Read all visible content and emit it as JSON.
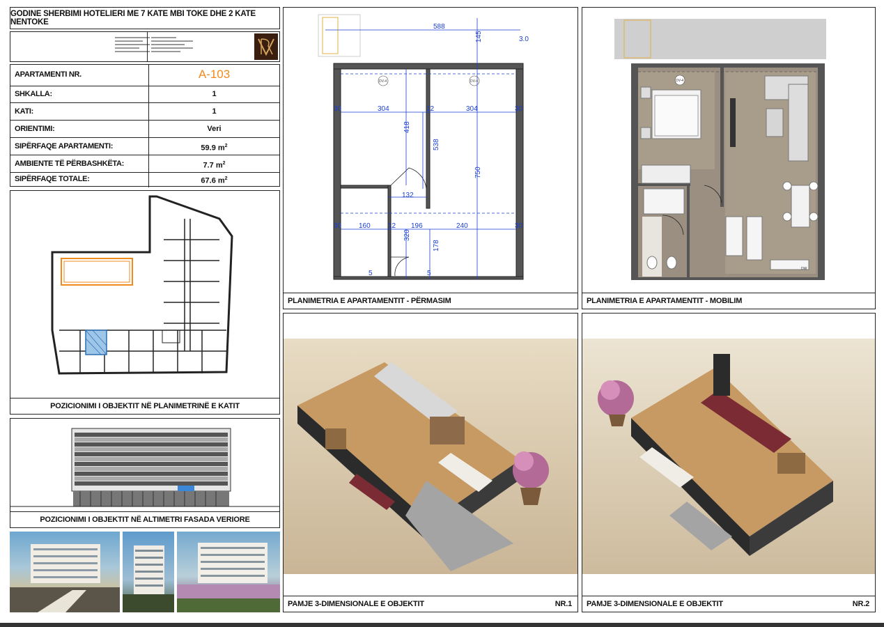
{
  "header": {
    "title": "GODINE SHERBIMI HOTELIERI ME 7 KATE MBI TOKE DHE 2 KATE NENTOKE"
  },
  "info_table": {
    "rows": [
      {
        "label": "APARTAMENTI NR.",
        "value": "A-103"
      },
      {
        "label": "SHKALLA:",
        "value": "1"
      },
      {
        "label": "KATI:",
        "value": "1"
      },
      {
        "label": "ORIENTIMI:",
        "value": "Veri"
      },
      {
        "label": "SIPËRFAQE APARTAMENTI:",
        "value": "59.9 m",
        "unit": "2"
      },
      {
        "label": "AMBIENTE TË PËRBASHKËTA:",
        "value": "7.7 m",
        "unit": "2"
      },
      {
        "label": "SIPËRFAQE TOTALE:",
        "value": "67.6 m",
        "unit": "2"
      }
    ],
    "accent": "#f08a1c"
  },
  "captions": {
    "floor_position": "POZICIONIMI I OBJEKTIT NË PLANIMETRINË E KATIT",
    "facade_position": "POZICIONIMI I OBJEKTIT NË ALTIMETRI FASADA VERIORE",
    "plan_dims": "PLANIMETRIA E APARTAMENTIT - PËRMASIM",
    "plan_furn": "PLANIMETRIA E APARTAMENTIT - MOBILIM",
    "view3d_1": "PAMJE 3-DIMENSIONALE E OBJEKTIT",
    "view3d_1_nr": "NR.1",
    "view3d_2": "PAMJE 3-DIMENSIONALE E OBJEKTIT",
    "view3d_2_nr": "NR.2"
  },
  "dimensions": {
    "d588": "588",
    "d145": "145",
    "d3": "3.0",
    "d30a": "30",
    "d304a": "304",
    "d12a": "12",
    "d304b": "304",
    "d30b": "30",
    "d418": "418",
    "d538": "538",
    "d750": "750",
    "d132": "132",
    "d30c": "30",
    "d160": "160",
    "d12b": "12",
    "d196": "196",
    "d240": "240",
    "d30d": "30",
    "d320": "320",
    "d178": "178",
    "d5a": "5",
    "d5b": "5",
    "dv4a": "DV-4",
    "dv4b": "DV-4",
    "dv4c": "DV-4",
    "dw": "DW"
  }
}
